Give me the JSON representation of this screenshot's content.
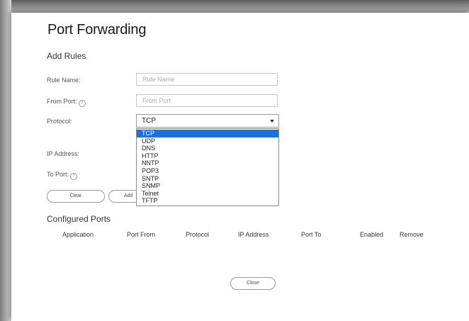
{
  "page": {
    "title": "Port Forwarding",
    "add_rules_heading": "Add Rules",
    "configured_ports_heading": "Configured Ports"
  },
  "form": {
    "rule_name_label": "Rule Name:",
    "rule_name_placeholder": "Rule Name",
    "from_port_label": "From Port:",
    "from_port_placeholder": "From Port",
    "protocol_label": "Protocol:",
    "protocol_value": "TCP",
    "ip_address_label": "IP Address:",
    "to_port_label": "To Port:",
    "help_glyph": "?",
    "clear_button": "Clear",
    "add_button": "Add"
  },
  "protocol_options": [
    "TCP",
    "UDP",
    "DNS",
    "HTTP",
    "NNTP",
    "POP3",
    "SNTP",
    "SNMP",
    "Telnet",
    "TFTP"
  ],
  "protocol_selected_index": 0,
  "table": {
    "columns": [
      "Application",
      "Port From",
      "Protocol",
      "IP Address",
      "Port To",
      "Enabled",
      "Remove"
    ]
  },
  "footer": {
    "close_button": "Close"
  },
  "colors": {
    "highlight": "#1e6fd9",
    "background": "#ffffff"
  }
}
